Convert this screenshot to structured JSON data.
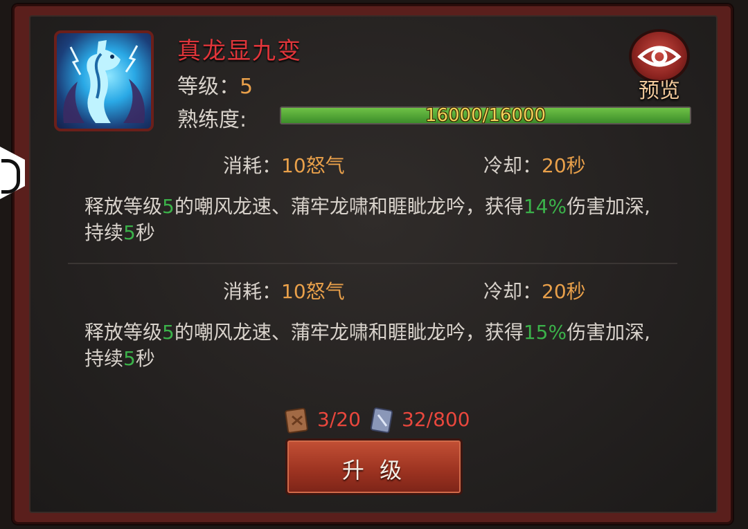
{
  "skill": {
    "name": "真龙显九变",
    "level_label": "等级：",
    "level_value": "5",
    "proficiency_label": "熟练度:",
    "proficiency_text": "16000/16000",
    "proficiency_fraction": 1.0
  },
  "preview_button": {
    "label": "预览",
    "icon": "eye-icon"
  },
  "tiers": [
    {
      "cost_label": "消耗：",
      "cost_value": "10怒气",
      "cooldown_label": "冷却：",
      "cooldown_value": "20秒",
      "desc_part1": "释放等级",
      "desc_level": "5",
      "desc_part2": "的嘲风龙速、蒲牢龙啸和睚眦龙吟，获得",
      "desc_bonus": "14%",
      "desc_part3": "伤害加深,持续",
      "desc_duration": "5",
      "desc_part4": "秒"
    },
    {
      "cost_label": "消耗：",
      "cost_value": "10怒气",
      "cooldown_label": "冷却：",
      "cooldown_value": "20秒",
      "desc_part1": "释放等级",
      "desc_level": "5",
      "desc_part2": "的嘲风龙速、蒲牢龙啸和睚眦龙吟，获得",
      "desc_bonus": "15%",
      "desc_part3": "伤害加深,持续",
      "desc_duration": "5",
      "desc_part4": "秒"
    }
  ],
  "upgrade_cost": {
    "book_count": "3/20",
    "scroll_count": "32/800"
  },
  "upgrade_button": {
    "label": "升 级"
  },
  "colors": {
    "title_red": "#e0353a",
    "value_orange": "#e9a04a",
    "highlight_green": "#3bb24a",
    "cost_red": "#e9473d",
    "progress_green": "#5bb03c"
  },
  "icons": [
    "dragon-skill-icon",
    "eye-icon",
    "skill-book-icon",
    "scroll-icon",
    "side-tab-icon"
  ]
}
